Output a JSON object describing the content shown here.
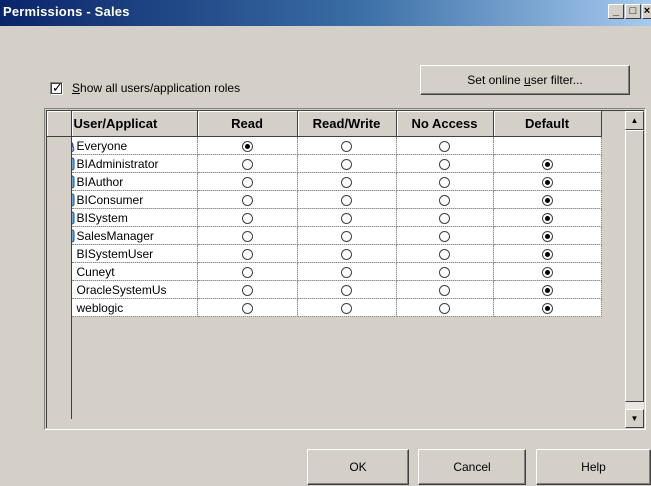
{
  "window": {
    "title": "Permissions - Sales",
    "minimize_glyph": "_",
    "maximize_glyph": "□",
    "close_glyph": "×"
  },
  "options": {
    "show_all_label_prefix": "",
    "show_all_label_accel": "S",
    "show_all_label_rest": "how all users/application roles",
    "show_all_checked": true,
    "filter_button_prefix": "Set online ",
    "filter_button_accel": "u",
    "filter_button_rest": "ser filter..."
  },
  "grid": {
    "columns": [
      "User/Applicat",
      "Read",
      "Read/Write",
      "No Access",
      "Default"
    ],
    "rows": [
      {
        "name": "Everyone",
        "icon": "globe-group-icon",
        "selected": "Read"
      },
      {
        "name": "BIAdministrator",
        "icon": "app-role-icon",
        "selected": "Default"
      },
      {
        "name": "BIAuthor",
        "icon": "app-role-icon",
        "selected": "Default"
      },
      {
        "name": "BIConsumer",
        "icon": "app-role-icon",
        "selected": "Default"
      },
      {
        "name": "BISystem",
        "icon": "app-role-icon",
        "selected": "Default"
      },
      {
        "name": "SalesManager",
        "icon": "app-role-icon",
        "selected": "Default"
      },
      {
        "name": "BISystemUser",
        "icon": "user-icon",
        "selected": "Default"
      },
      {
        "name": "Cuneyt",
        "icon": "user-icon",
        "selected": "Default"
      },
      {
        "name": "OracleSystemUs",
        "icon": "user-icon",
        "selected": "Default"
      },
      {
        "name": "weblogic",
        "icon": "user-icon",
        "selected": "Default"
      }
    ]
  },
  "scrollbar": {
    "up_arrow": "▲",
    "down_arrow": "▼"
  },
  "buttons": {
    "ok": "OK",
    "cancel": "Cancel",
    "help": "Help"
  },
  "colors": {
    "title_start": "#0a246a",
    "title_end": "#a6caf0",
    "face": "#d4d0c8"
  }
}
